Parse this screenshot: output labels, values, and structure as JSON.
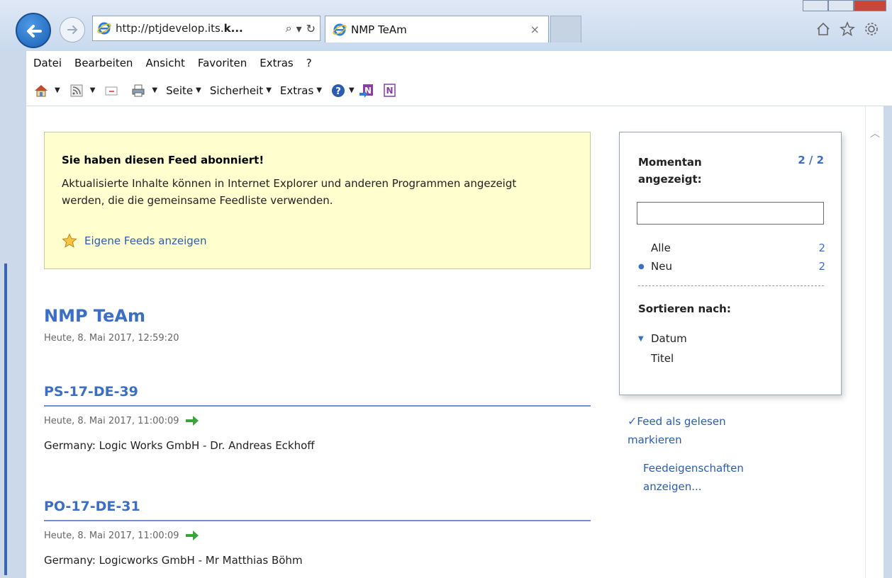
{
  "browser": {
    "address_url_prefix": "http://ptjdevelop.its.",
    "address_url_bold": "k...",
    "search_glyph": "⌕",
    "dropdown_glyph": "▾",
    "refresh_glyph": "↻",
    "tab_title": "NMP TeAm",
    "tab_close": "×"
  },
  "menu": [
    "Datei",
    "Bearbeiten",
    "Ansicht",
    "Favoriten",
    "Extras",
    "?"
  ],
  "commands": {
    "page": "Seite",
    "security": "Sicherheit",
    "tools": "Extras"
  },
  "subscription": {
    "title": "Sie haben diesen Feed abonniert!",
    "text": "Aktualisierte Inhalte können in Internet Explorer und anderen Programmen angezeigt werden, die die gemeinsame Feedliste verwenden.",
    "link": "Eigene Feeds anzeigen"
  },
  "feed": {
    "title": "NMP TeAm",
    "date": "Heute, 8. Mai 2017, 12:59:20",
    "entries": [
      {
        "title": "PS-17-DE-39",
        "date": "Heute, 8. Mai 2017, 11:00:09",
        "description": "Germany: Logic Works GmbH - Dr. Andreas Eckhoff"
      },
      {
        "title": "PO-17-DE-31",
        "date": "Heute, 8. Mai 2017, 11:00:09",
        "description": "Germany: Logicworks GmbH - Mr Matthias Böhm"
      }
    ]
  },
  "panel": {
    "heading": "Momentan angezeigt:",
    "count": "2 / 2",
    "filters": [
      {
        "label": "Alle",
        "count": "2"
      },
      {
        "label": "Neu",
        "count": "2"
      }
    ],
    "sort_heading": "Sortieren nach:",
    "sort_options": [
      "Datum",
      "Titel"
    ]
  },
  "actions": {
    "mark_read": "Feed als gelesen markieren",
    "properties": "Feedeigenschaften anzeigen..."
  },
  "colors": {
    "accent": "#3a6fc4",
    "notice_bg": "#fefecf",
    "link": "#2a5db0"
  }
}
